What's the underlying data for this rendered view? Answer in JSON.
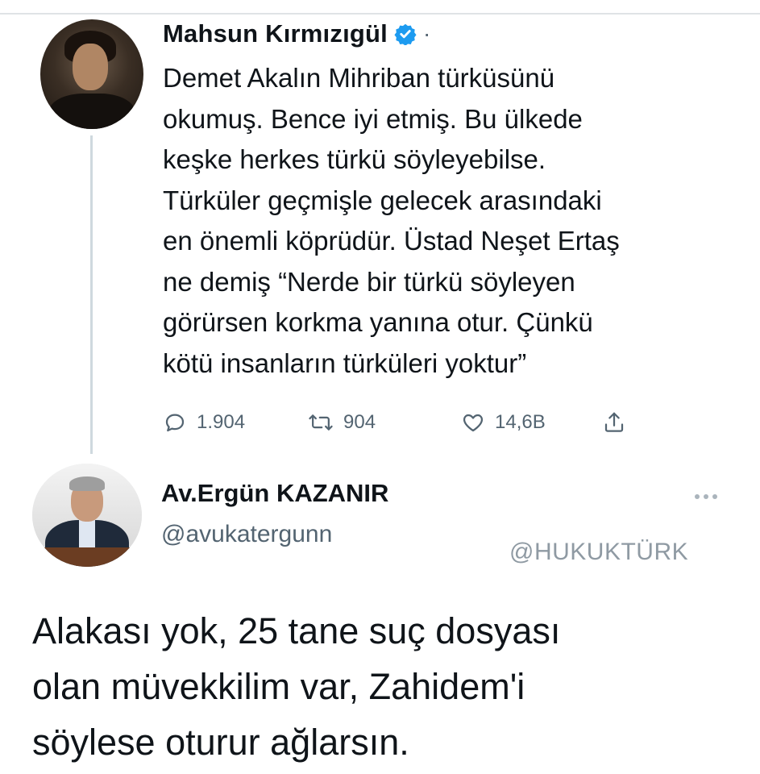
{
  "tweet": {
    "author_name": "Mahsun Kırmızıgül",
    "separator": "·",
    "text": "Demet Akalın Mihriban türküsünü\nokumuş. Bence iyi etmiş. Bu ülkede\nkeşke herkes türkü söyleyebilse.\nTürküler geçmişle gelecek arasındaki\nen önemli köprüdür. Üstad Neşet Ertaş\nne demiş  “Nerde bir türkü söyleyen\ngörürsen korkma yanına otur. Çünkü\nkötü insanların türküleri yoktur”",
    "replies": "1.904",
    "retweets": "904",
    "likes": "14,6B"
  },
  "reply_tweet": {
    "author_name": "Av.Ergün KAZANIR",
    "handle": "@avukatergunn",
    "watermark": "@HUKUKTÜRK",
    "text": "Alakası yok, 25 tane suç dosyası\nolan müvekkilim var, Zahidem'i\nsöylese oturur ağlarsın."
  },
  "icons": {
    "verified": "verified-badge-icon",
    "reply": "reply-icon",
    "retweet": "retweet-icon",
    "like": "heart-icon",
    "share": "share-icon",
    "more": "more-options-icon"
  },
  "colors": {
    "verified": "#1d9bf0",
    "text": "#0f1419",
    "muted": "#536471"
  }
}
